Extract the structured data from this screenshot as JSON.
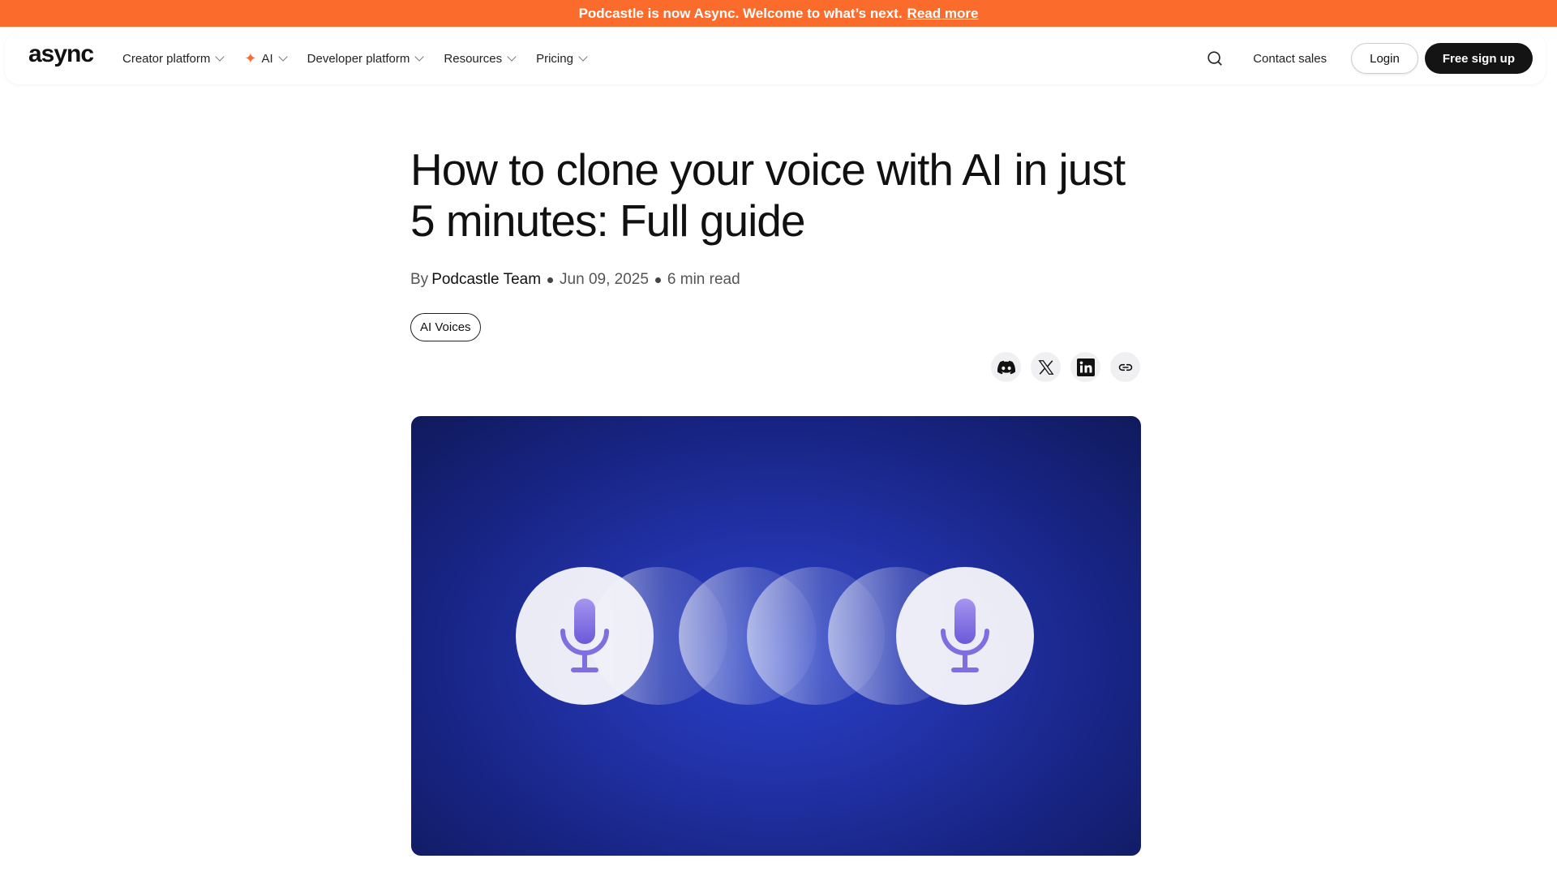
{
  "banner": {
    "text": "Podcastle is now Async. Welcome to what’s next.",
    "link": "Read more",
    "color": "#fb6c2c"
  },
  "nav": {
    "logo": "async",
    "items": [
      {
        "label": "Creator platform",
        "icon": "chevron-down-icon"
      },
      {
        "label": "AI",
        "icon": "sparkle-icon"
      },
      {
        "label": "Developer platform",
        "icon": "chevron-down-icon"
      },
      {
        "label": "Resources",
        "icon": "chevron-down-icon"
      },
      {
        "label": "Pricing",
        "icon": "chevron-down-icon"
      }
    ],
    "search_icon": "search-icon",
    "contact": "Contact sales",
    "login": "Login",
    "signup": "Free sign up"
  },
  "article": {
    "title": "How to clone your voice with AI in just 5 minutes: Full guide",
    "by": "By",
    "author": "Podcastle Team",
    "date": "Jun 09, 2025",
    "read_time": "6 min read",
    "tag": "AI Voices",
    "share": [
      "discord-icon",
      "x-icon",
      "linkedin-icon",
      "link-icon"
    ]
  },
  "hero": {
    "description_icons": [
      "microphone-icon",
      "microphone-icon"
    ],
    "background": "#2232a8",
    "mic_color": "#8a7ce6"
  }
}
